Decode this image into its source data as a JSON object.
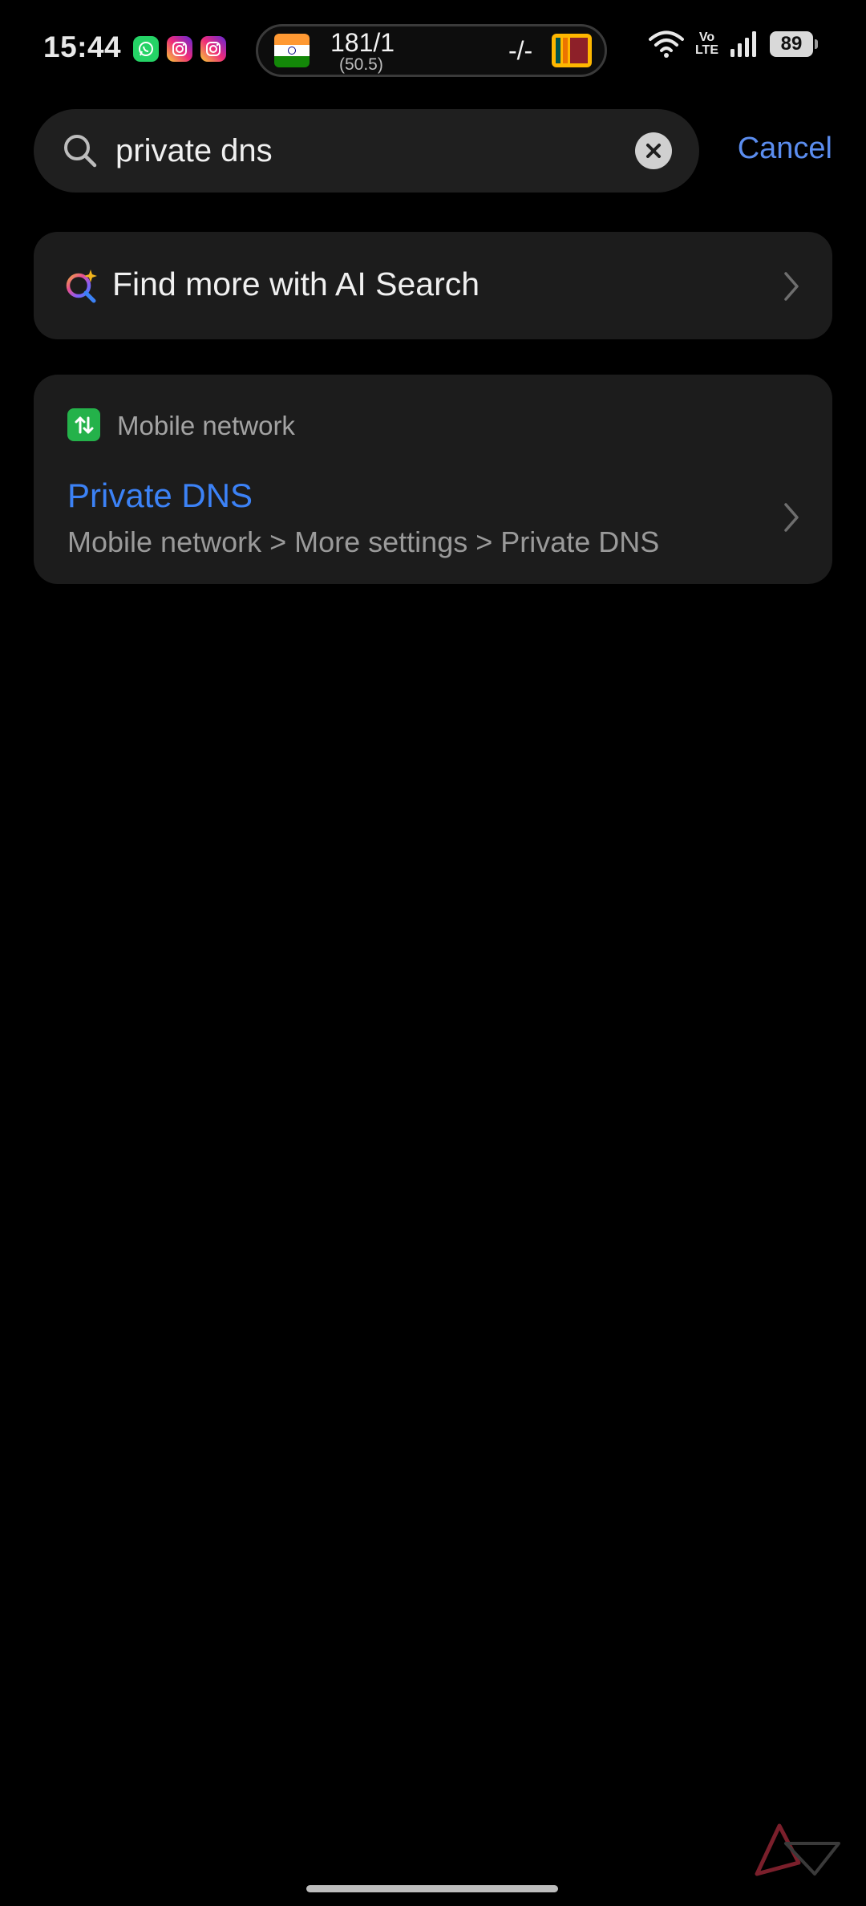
{
  "status_bar": {
    "time": "15:44",
    "notification_icons": [
      "whatsapp-icon",
      "instagram-icon",
      "instagram-icon"
    ],
    "score": {
      "team1_flag": "india-flag-icon",
      "team1_score": "181/1",
      "team1_overs": "(50.5)",
      "team2_score": "-/-",
      "team2_flag": "sri-lanka-flag-icon"
    },
    "volte_top": "Vo",
    "volte_bottom": "LTE",
    "battery": "89"
  },
  "search": {
    "query": "private dns",
    "cancel_label": "Cancel"
  },
  "ai_search": {
    "label": "Find more with AI Search"
  },
  "result": {
    "category": "Mobile network",
    "title": "Private DNS",
    "path": "Mobile network > More settings > Private DNS"
  },
  "colors": {
    "accent_blue": "#3c82f6",
    "cancel_blue": "#5b8def",
    "card_background": "#1c1c1c",
    "category_green": "#24b24a"
  }
}
